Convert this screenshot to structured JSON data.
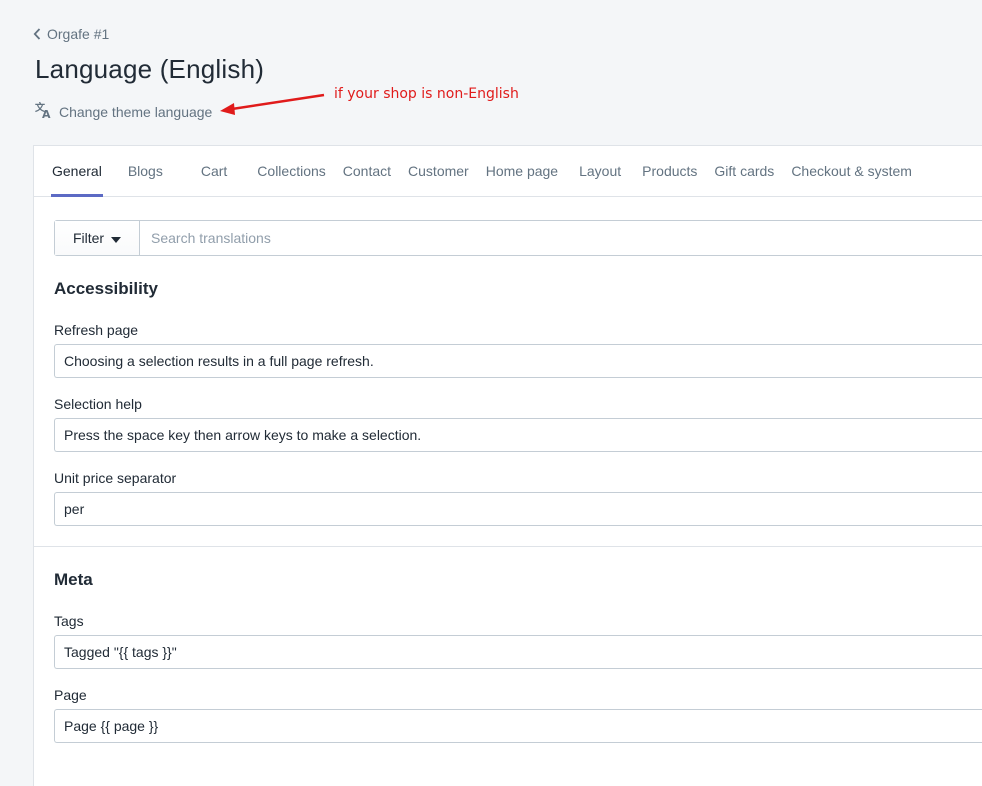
{
  "breadcrumb": {
    "label": "Orgafe #1",
    "icon": "chevron-left-icon"
  },
  "page": {
    "title": "Language (English)",
    "change_language_label": "Change theme language",
    "change_language_icon": "translate-icon"
  },
  "annotation": {
    "text": "if your shop is non-English",
    "color": "#e01b1b"
  },
  "tabs": [
    {
      "label": "General",
      "active": true
    },
    {
      "label": "Blogs"
    },
    {
      "label": "Cart"
    },
    {
      "label": "Collections"
    },
    {
      "label": "Contact"
    },
    {
      "label": "Customer"
    },
    {
      "label": "Home page"
    },
    {
      "label": "Layout"
    },
    {
      "label": "Products"
    },
    {
      "label": "Gift cards"
    },
    {
      "label": "Checkout & system"
    }
  ],
  "filter": {
    "button_label": "Filter",
    "button_icon": "caret-down-icon",
    "search_placeholder": "Search translations"
  },
  "sections": {
    "accessibility": {
      "title": "Accessibility",
      "fields": [
        {
          "label": "Refresh page",
          "value": "Choosing a selection results in a full page refresh."
        },
        {
          "label": "Selection help",
          "value": "Press the space key then arrow keys to make a selection."
        },
        {
          "label": "Unit price separator",
          "value": "per"
        }
      ]
    },
    "meta": {
      "title": "Meta",
      "fields": [
        {
          "label": "Tags",
          "value": "Tagged \"{{ tags }}\""
        },
        {
          "label": "Page",
          "value": "Page {{ page }}"
        }
      ]
    }
  },
  "colors": {
    "accent": "#5c6ac4",
    "text": "#212b36",
    "muted": "#637381",
    "border": "#c4cdd5"
  }
}
